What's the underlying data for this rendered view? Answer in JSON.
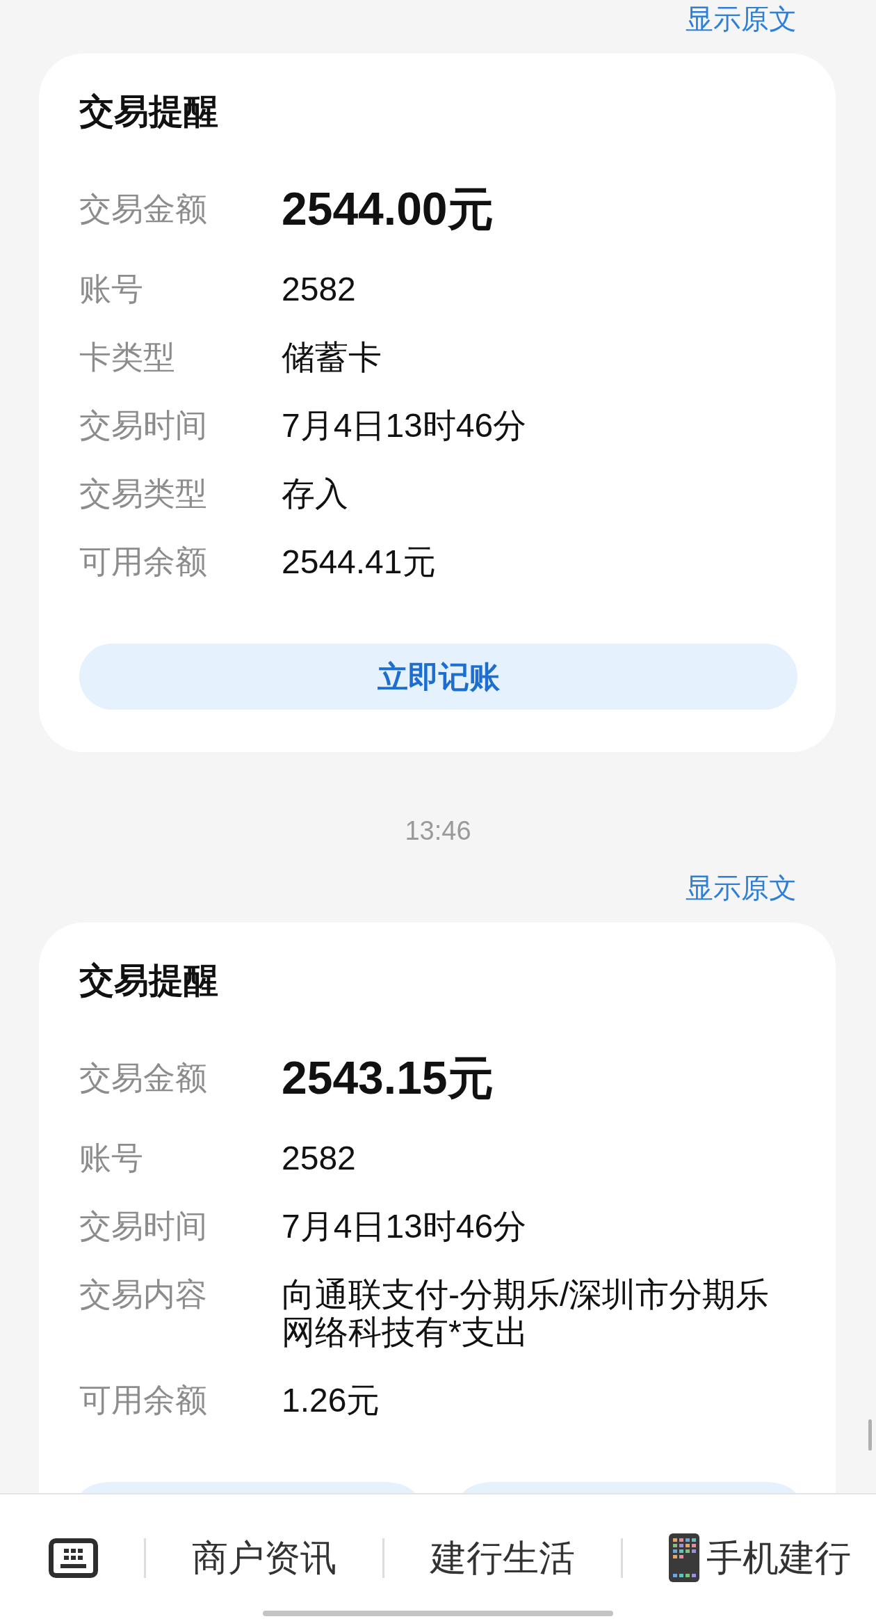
{
  "messages": [
    {
      "kind": "sms",
      "show_original": "显示原文",
      "card": {
        "title": "交易提醒",
        "fields": [
          {
            "kind": "amount",
            "label": "交易金额",
            "value": "2544.00元"
          },
          {
            "kind": "text",
            "label": "账号",
            "value": "2582"
          },
          {
            "kind": "text",
            "label": "卡类型",
            "value": "储蓄卡"
          },
          {
            "kind": "text",
            "label": "交易时间",
            "value": "7月4日13时46分"
          },
          {
            "kind": "text",
            "label": "交易类型",
            "value": "存入"
          },
          {
            "kind": "text",
            "label": "可用余额",
            "value": "2544.41元"
          }
        ],
        "buttons": [
          {
            "kind": "full",
            "label": "立即记账"
          }
        ]
      }
    },
    {
      "kind": "time",
      "text": "13:46"
    },
    {
      "kind": "sms",
      "show_original": "显示原文",
      "card": {
        "title": "交易提醒",
        "fields": [
          {
            "kind": "amount",
            "label": "交易金额",
            "value": "2543.15元"
          },
          {
            "kind": "text",
            "label": "账号",
            "value": "2582"
          },
          {
            "kind": "text",
            "label": "交易时间",
            "value": "7月4日13时46分"
          },
          {
            "kind": "text",
            "label": "交易内容",
            "value": "向通联支付-分期乐/深圳市分期乐网络科技有*支出"
          },
          {
            "kind": "text",
            "label": "可用余额",
            "value": "1.26元"
          }
        ],
        "buttons": [
          {
            "kind": "cut"
          },
          {
            "kind": "cut"
          }
        ]
      }
    }
  ],
  "bottom_bar": {
    "items": [
      {
        "kind": "keyboard"
      },
      {
        "kind": "menu",
        "label": "商户资讯"
      },
      {
        "kind": "menu",
        "label": "建行生活"
      },
      {
        "kind": "icon_menu",
        "label": "手机建行"
      }
    ]
  }
}
